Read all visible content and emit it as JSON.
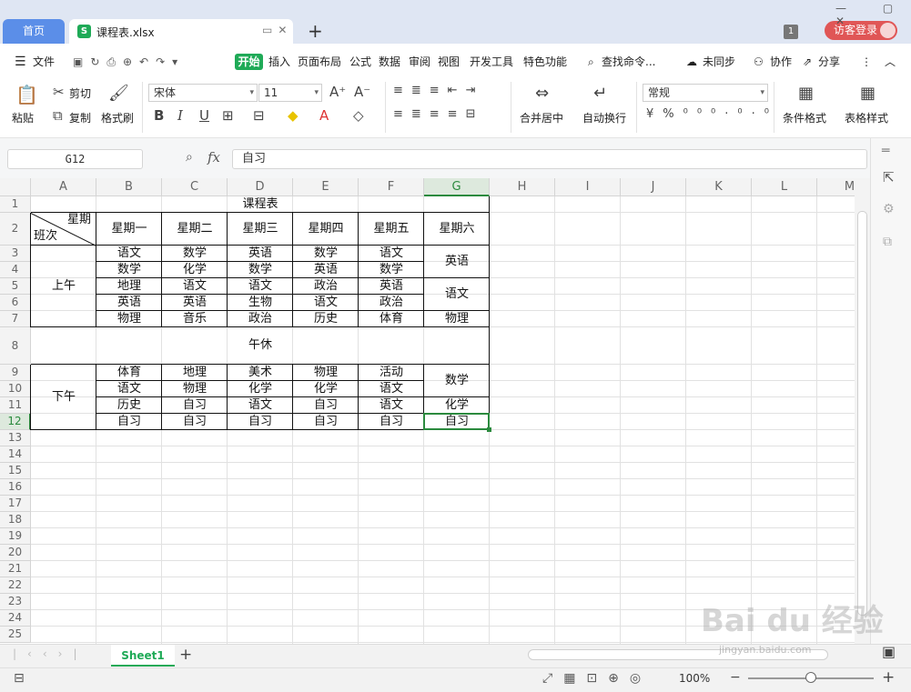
{
  "window": {
    "home_tab": "首页",
    "file_tab": "课程表.xlsx",
    "file_icon": "S",
    "new_tab": "+",
    "page_count": "1",
    "login": "访客登录",
    "controls": "— ▢ ✕"
  },
  "menu": {
    "file": "文件",
    "tabs": [
      "开始",
      "插入",
      "页面布局",
      "公式",
      "数据",
      "审阅",
      "视图",
      "开发工具",
      "特色功能"
    ],
    "search": "查找命令...",
    "sync": "未同步",
    "collab": "协作",
    "share": "分享"
  },
  "ribbon": {
    "paste": "粘贴",
    "cut": "剪切",
    "copy": "复制",
    "format_painter": "格式刷",
    "font_name": "宋体",
    "font_size": "11",
    "merge": "合并居中",
    "wrap": "自动换行",
    "number_format": "常规",
    "cond_format": "条件格式",
    "table_style": "表格样式"
  },
  "formula_bar": {
    "cell_ref": "G12",
    "fx": "fx",
    "value": "自习"
  },
  "columns": [
    "A",
    "B",
    "C",
    "D",
    "E",
    "F",
    "G",
    "H",
    "I",
    "J",
    "K",
    "L",
    "M"
  ],
  "selected_column": "G",
  "selected_row": "12",
  "rows": [
    "1",
    "2",
    "3",
    "4",
    "5",
    "6",
    "7",
    "8",
    "9",
    "10",
    "11",
    "12",
    "13",
    "14",
    "15",
    "16",
    "17",
    "18",
    "19",
    "20",
    "21",
    "22",
    "23",
    "24",
    "25"
  ],
  "sheet": {
    "title": "课程表",
    "corner_top": "星期",
    "corner_bottom": "班次",
    "days": [
      "星期一",
      "星期二",
      "星期三",
      "星期四",
      "星期五",
      "星期六"
    ],
    "morning_label": "上午",
    "noon_label": "午休",
    "afternoon_label": "下午",
    "morning": [
      [
        "语文",
        "数学",
        "英语",
        "数学",
        "语文"
      ],
      [
        "数学",
        "化学",
        "数学",
        "英语",
        "数学"
      ],
      [
        "地理",
        "语文",
        "语文",
        "政治",
        "英语"
      ],
      [
        "英语",
        "英语",
        "生物",
        "语文",
        "政治"
      ],
      [
        "物理",
        "音乐",
        "政治",
        "历史",
        "体育"
      ]
    ],
    "morning_sat": [
      "英语",
      "语文",
      "物理"
    ],
    "afternoon": [
      [
        "体育",
        "地理",
        "美术",
        "物理",
        "活动"
      ],
      [
        "语文",
        "物理",
        "化学",
        "化学",
        "语文"
      ],
      [
        "历史",
        "自习",
        "语文",
        "自习",
        "语文"
      ],
      [
        "自习",
        "自习",
        "自习",
        "自习",
        "自习"
      ]
    ],
    "afternoon_sat": [
      "数学",
      "化学",
      "自习"
    ]
  },
  "sheet_tabs": [
    "Sheet1"
  ],
  "add_sheet": "+",
  "status": {
    "zoom": "100%"
  },
  "watermark": {
    "brand": "Bai du 经验",
    "url": "jingyan.baidu.com"
  }
}
